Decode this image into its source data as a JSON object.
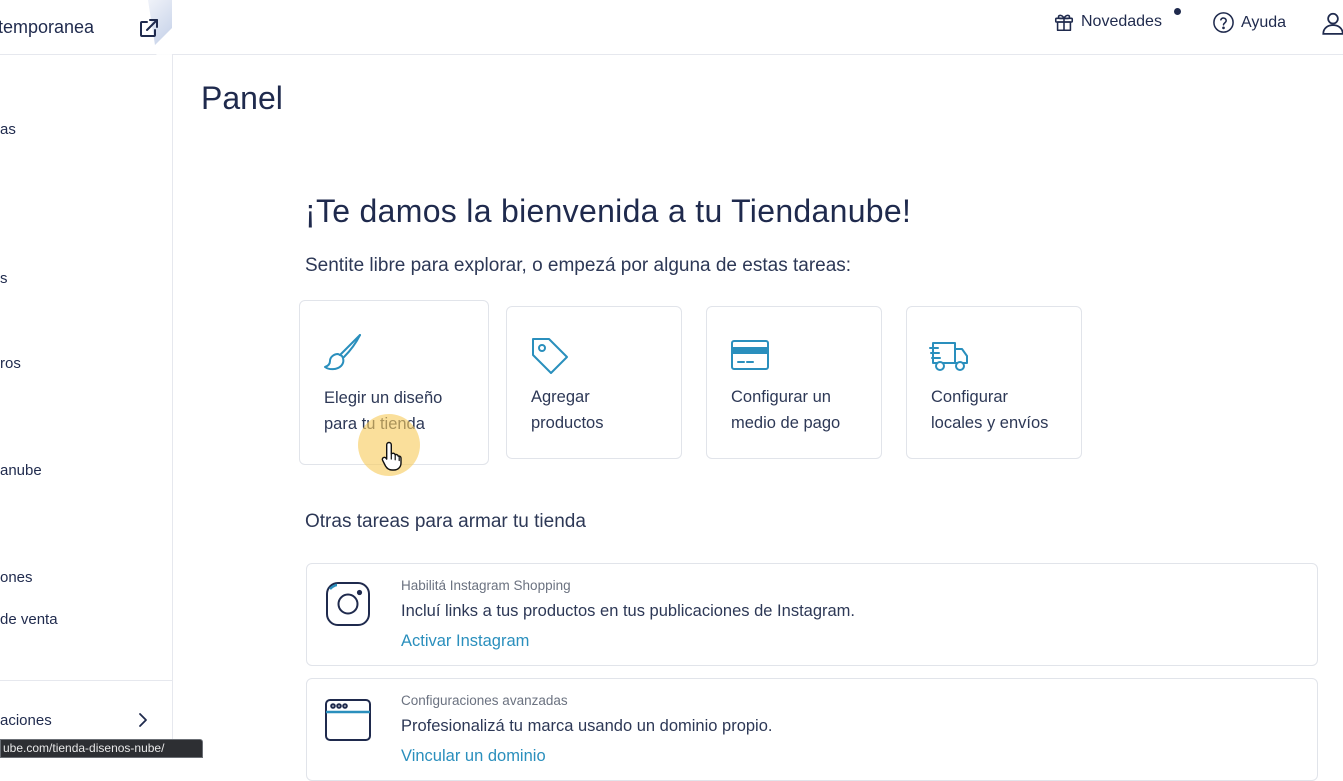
{
  "sidebar": {
    "store_name": "temporanea",
    "items": [
      {
        "label": "as"
      },
      {
        "label": "s"
      },
      {
        "label": "ros"
      },
      {
        "label": "anube"
      },
      {
        "label": "ones"
      },
      {
        "label": "de venta"
      },
      {
        "label": "aciones"
      }
    ],
    "status_url": "ube.com/tienda-disenos-nube/"
  },
  "topbar": {
    "news_label": "Novedades",
    "help_label": "Ayuda"
  },
  "page": {
    "title": "Panel",
    "welcome": "¡Te damos la bienvenida a tu Tiendanube!",
    "subtitle": "Sentite libre para explorar, o empezá por alguna de estas tareas:"
  },
  "tasks": [
    {
      "line1": "Elegir un diseño",
      "line2": "para tu tienda",
      "icon": "brush-icon"
    },
    {
      "line1": "Agregar",
      "line2": "productos",
      "icon": "tag-icon"
    },
    {
      "line1": "Configurar un",
      "line2": "medio de pago",
      "icon": "credit-card-icon"
    },
    {
      "line1": "Configurar",
      "line2": "locales y envíos",
      "icon": "truck-icon"
    }
  ],
  "other_tasks": {
    "title": "Otras tareas para armar tu tienda",
    "rows": [
      {
        "kicker": "Habilitá Instagram Shopping",
        "text": "Incluí links a tus productos en tus publicaciones de Instagram.",
        "link": "Activar Instagram",
        "icon": "instagram-icon"
      },
      {
        "kicker": "Configuraciones avanzadas",
        "text": "Profesionalizá tu marca usando un dominio propio.",
        "link": "Vincular un dominio",
        "icon": "browser-window-icon"
      }
    ]
  },
  "colors": {
    "accent": "#2a8fbd",
    "text": "#1f2a4d",
    "cursor_highlight": "#f7cc5e"
  }
}
